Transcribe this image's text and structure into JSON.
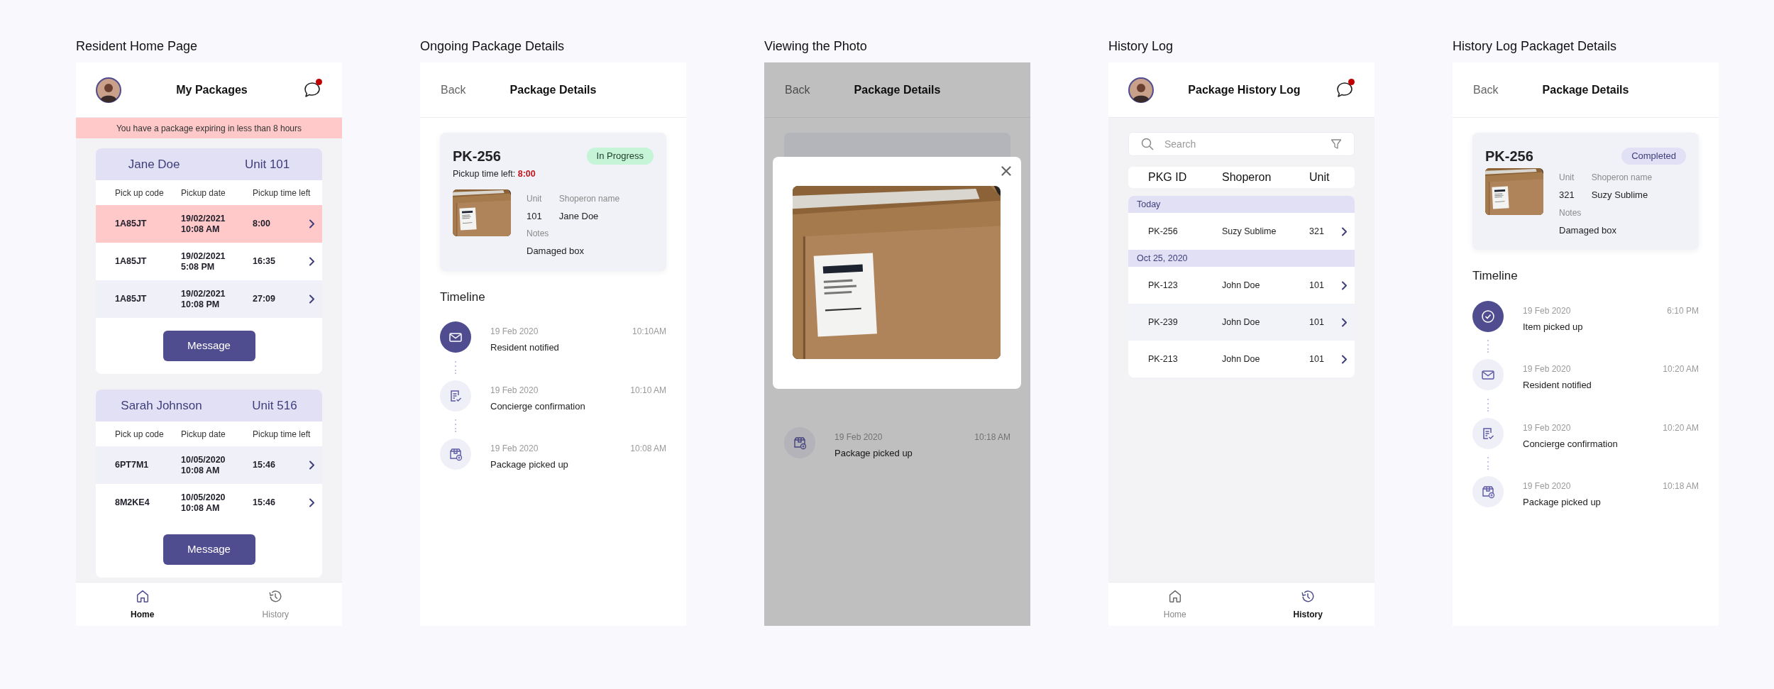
{
  "screens": [
    {
      "kind": "home",
      "caption": "Resident Home Page",
      "title": "My Packages",
      "has_unread": true,
      "alert": "You have a package expiring in less than 8 hours",
      "groups": [
        {
          "name": "Jane Doe",
          "unit": "Unit 101",
          "columns": [
            "Pick up code",
            "Pickup date",
            "Pickup time left"
          ],
          "button": "Message",
          "rows": [
            {
              "code": "1A85JT",
              "date": "19/02/2021",
              "time": "10:08 AM",
              "left": "8:00",
              "urgent": true
            },
            {
              "code": "1A85JT",
              "date": "19/02/2021",
              "time": "5:08 PM",
              "left": "16:35",
              "urgent": false,
              "highlighted": false
            },
            {
              "code": "1A85JT",
              "date": "19/02/2021",
              "time": "10:08 PM",
              "left": "27:09",
              "urgent": false,
              "highlighted": true
            }
          ]
        },
        {
          "name": "Sarah Johnson",
          "unit": "Unit 516",
          "columns": [
            "Pick up code",
            "Pickup date",
            "Pickup time left"
          ],
          "button": "Message",
          "rows": [
            {
              "code": "6PT7M1",
              "date": "10/05/2020",
              "time": "10:08 AM",
              "left": "15:46",
              "urgent": false,
              "highlighted": true
            },
            {
              "code": "8M2KE4",
              "date": "10/05/2020",
              "time": "10:08 AM",
              "left": "15:46",
              "urgent": false,
              "highlighted": false
            }
          ]
        }
      ],
      "nav": [
        {
          "kind": "home",
          "label": "Home",
          "selected": true
        },
        {
          "kind": "history",
          "label": "History",
          "selected": false
        }
      ]
    },
    {
      "kind": "details",
      "caption": "Ongoing Package Details",
      "back": "Back",
      "title": "Package Details",
      "package": {
        "id": "PK-256",
        "status": "In Progress",
        "completed": false,
        "time_left_label": "Pickup time left:",
        "time_left": "8:00",
        "unit_label": "Unit",
        "unit": "101",
        "name_label": "Shoperon name",
        "name": "Jane Doe",
        "notes_label": "Notes",
        "notes": "Damaged box"
      },
      "timeline_title": "Timeline",
      "timeline": [
        {
          "kind": "mail",
          "date": "19 Feb 2020",
          "time": "10:10AM",
          "event": "Resident notified",
          "current": true
        },
        {
          "kind": "checklist",
          "date": "19 Feb 2020",
          "time": "10:10 AM",
          "event": "Concierge confirmation",
          "current": false
        },
        {
          "kind": "box",
          "date": "19 Feb 2020",
          "time": "10:08 AM",
          "event": "Package picked up",
          "current": false
        }
      ]
    },
    {
      "caption": "Viewing the Photo",
      "back": "Back",
      "title": "Package Details",
      "timeline": [
        {
          "kind": "box",
          "date": "19 Feb 2020",
          "time": "10:18 AM",
          "event": "Package picked up",
          "current": false
        }
      ]
    },
    {
      "kind": "history",
      "caption": "History Log",
      "title": "Package History Log",
      "has_unread": true,
      "search": {
        "placeholder": "Search"
      },
      "columns": [
        "PKG ID",
        "Shoperon",
        "Unit"
      ],
      "groups": [
        {
          "label": "Today",
          "rows": [
            {
              "id": "PK-256",
              "name": "Suzy Sublime",
              "unit": "321",
              "highlighted": false
            }
          ]
        },
        {
          "label": "Oct 25, 2020",
          "rows": [
            {
              "id": "PK-123",
              "name": "John Doe",
              "unit": "101",
              "highlighted": false
            },
            {
              "id": "PK-239",
              "name": "John Doe",
              "unit": "101",
              "highlighted": true
            },
            {
              "id": "PK-213",
              "name": "John Doe",
              "unit": "101",
              "highlighted": false
            }
          ]
        }
      ],
      "nav": [
        {
          "kind": "home",
          "label": "Home",
          "selected": false
        },
        {
          "kind": "history",
          "label": "History",
          "selected": true
        }
      ]
    },
    {
      "kind": "details",
      "caption": "History Log Packaget Details",
      "back": "Back",
      "title": "Package Details",
      "package": {
        "id": "PK-256",
        "status": "Completed",
        "completed": true,
        "unit_label": "Unit",
        "unit": "321",
        "name_label": "Shoperon name",
        "name": "Suzy Sublime",
        "notes_label": "Notes",
        "notes": "Damaged box"
      },
      "timeline_title": "Timeline",
      "timeline": [
        {
          "kind": "check",
          "date": "19 Feb 2020",
          "time": "6:10 PM",
          "event": "Item picked up",
          "current": true
        },
        {
          "kind": "mail",
          "date": "19 Feb 2020",
          "time": "10:20 AM",
          "event": "Resident notified",
          "current": false
        },
        {
          "kind": "checklist",
          "date": "19 Feb 2020",
          "time": "10:20 AM",
          "event": "Concierge confirmation",
          "current": false
        },
        {
          "kind": "box",
          "date": "19 Feb 2020",
          "time": "10:18 AM",
          "event": "Package picked up",
          "current": false
        }
      ]
    }
  ]
}
